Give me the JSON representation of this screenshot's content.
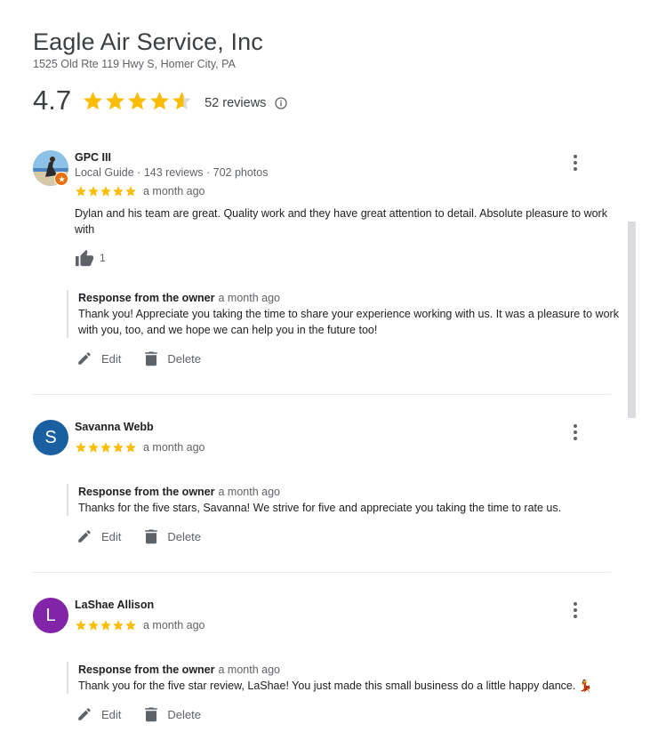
{
  "business": {
    "name": "Eagle Air Service, Inc",
    "address": "1525 Old Rte 119 Hwy S, Homer City, PA",
    "rating": "4.7",
    "stars_filled": 4.7,
    "reviews_count": "52 reviews"
  },
  "colors": {
    "star": "#fbbc04",
    "star_empty": "#dadce0",
    "avatar_s": "#1a5fa0",
    "avatar_l": "#8224a8",
    "badge": "#e8710a"
  },
  "reviews": [
    {
      "name": "GPC III",
      "meta": "Local Guide · 143 reviews · 702 photos",
      "stars": 5,
      "time": "a month ago",
      "text": "Dylan and his team are great. Quality work and they have great attention to detail. Absolute pleasure to work with",
      "likes": "1",
      "owner_label": "Response from the owner",
      "owner_time": "a month ago",
      "owner_text": "Thank you! Appreciate you taking the time to share your experience working with us. It was a pleasure to work with you, too, and we hope we can help you in the future too!",
      "edit": "Edit",
      "delete": "Delete"
    },
    {
      "name": "Savanna Webb",
      "initial": "S",
      "stars": 5,
      "time": "a month ago",
      "owner_label": "Response from the owner",
      "owner_time": "a month ago",
      "owner_text": "Thanks for the five stars, Savanna! We strive for five and appreciate you taking the time to rate us.",
      "edit": "Edit",
      "delete": "Delete"
    },
    {
      "name": "LaShae Allison",
      "initial": "L",
      "stars": 5,
      "time": "a month ago",
      "owner_label": "Response from the owner",
      "owner_time": "a month ago",
      "owner_text": "Thank you for the five star review, LaShae! You just made this small business do a little happy dance. 💃",
      "edit": "Edit",
      "delete": "Delete"
    }
  ]
}
